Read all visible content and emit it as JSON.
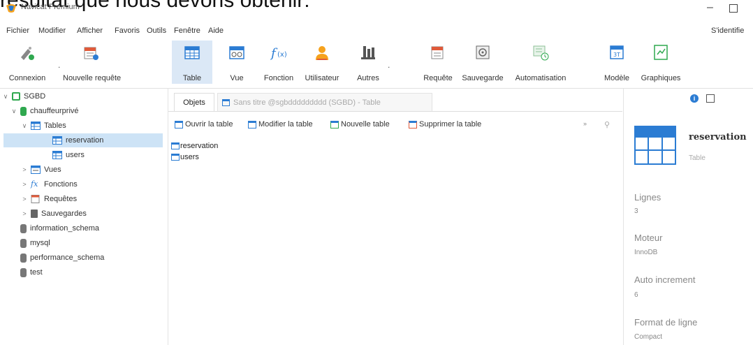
{
  "caption": "résultat que nous devons obtenir:",
  "app": {
    "title": "Navicat Premium"
  },
  "menu": {
    "items": [
      "Fichier",
      "Modifier",
      "Afficher",
      "Favoris",
      "Outils",
      "Fenêtre",
      "Aide"
    ],
    "signin": "S'identifie"
  },
  "ribbon": {
    "buttons": [
      {
        "label": "Connexion",
        "icon": "connection-icon"
      },
      {
        "label": "Nouvelle requête",
        "icon": "new-query-icon"
      },
      {
        "label": "Table",
        "icon": "table-icon",
        "active": true
      },
      {
        "label": "Vue",
        "icon": "view-icon"
      },
      {
        "label": "Fonction",
        "icon": "function-icon"
      },
      {
        "label": "Utilisateur",
        "icon": "user-icon"
      },
      {
        "label": "Autres",
        "icon": "others-icon"
      },
      {
        "label": "Requête",
        "icon": "query-icon"
      },
      {
        "label": "Sauvegarde",
        "icon": "backup-icon"
      },
      {
        "label": "Automatisation",
        "icon": "automation-icon"
      },
      {
        "label": "Modèle",
        "icon": "model-icon"
      },
      {
        "label": "Graphiques",
        "icon": "charts-icon"
      }
    ]
  },
  "sidebar": {
    "items": [
      {
        "label": "SGBD"
      },
      {
        "label": "chauffeurprivé"
      },
      {
        "label": "Tables"
      },
      {
        "label": "reservation"
      },
      {
        "label": "users"
      },
      {
        "label": "Vues"
      },
      {
        "label": "Fonctions"
      },
      {
        "label": "Requêtes"
      },
      {
        "label": "Sauvegardes"
      },
      {
        "label": "information_schema"
      },
      {
        "label": "mysql"
      },
      {
        "label": "performance_schema"
      },
      {
        "label": "test"
      }
    ]
  },
  "tabs": {
    "objects": "Objets",
    "query": "Sans titre @sgbddddddddd (SGBD) - Table"
  },
  "objtoolbar": {
    "open": "Ouvrir la table",
    "modify": "Modifier la table",
    "new": "Nouvelle table",
    "delete": "Supprimer la table"
  },
  "objects": [
    "reservation",
    "users"
  ],
  "info": {
    "name": "reservation",
    "type": "Table",
    "rows_label": "Lignes",
    "rows_value": "3",
    "engine_label": "Moteur",
    "engine_value": "InnoDB",
    "autoinc_label": "Auto increment",
    "autoinc_value": "6",
    "format_label": "Format de ligne",
    "format_value": "Compact"
  },
  "colors": {
    "accent": "#2b7cd3",
    "selected": "#cde3f6",
    "green": "#2fa84f",
    "red": "#e05a3a"
  }
}
